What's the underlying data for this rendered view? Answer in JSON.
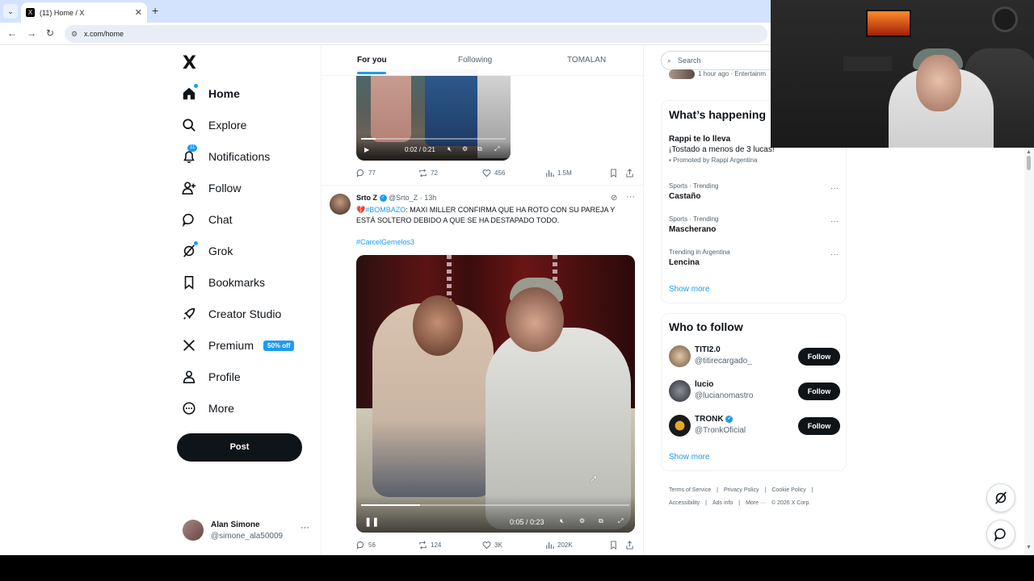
{
  "browser": {
    "tab_title": "(11) Home / X",
    "favicon": "X",
    "url": "x.com/home"
  },
  "nav": {
    "logo": "X",
    "items": [
      {
        "label": "Home",
        "icon": "home-icon",
        "active": true
      },
      {
        "label": "Explore",
        "icon": "search-icon"
      },
      {
        "label": "Notifications",
        "icon": "bell-icon",
        "badge": "11"
      },
      {
        "label": "Follow",
        "icon": "add-person-icon"
      },
      {
        "label": "Chat",
        "icon": "chat-icon"
      },
      {
        "label": "Grok",
        "icon": "grok-icon"
      },
      {
        "label": "Bookmarks",
        "icon": "bookmark-icon"
      },
      {
        "label": "Creator Studio",
        "icon": "rocket-icon"
      },
      {
        "label": "Premium",
        "icon": "x-icon",
        "tag": "50% off"
      },
      {
        "label": "Profile",
        "icon": "person-icon"
      },
      {
        "label": "More",
        "icon": "more-circle-icon"
      }
    ],
    "post_label": "Post",
    "account": {
      "name": "Alan Simone",
      "handle": "@simone_ala50009"
    }
  },
  "feed": {
    "tabs": [
      "For you",
      "Following",
      "TOMALAN"
    ],
    "tweet1": {
      "video_time": "0:02 / 0:21",
      "video_progress": 0.1,
      "replies": "77",
      "reposts": "72",
      "likes": "456",
      "views": "1.5M"
    },
    "tweet2": {
      "name": "Srto Z",
      "handle": "@Srto_Z",
      "time": "13h",
      "emoji": "💔",
      "hashtag1": "#BOMBAZO",
      "text": ": MAXI MILLER CONFIRMA QUE HA ROTO CON SU PAREJA Y ESTÁ SOLTERO DEBIDO A QUE SE HA DESTAPADO TODO.",
      "hashtag2": "#CarcelGemelos3",
      "video_time": "0:05 / 0:23",
      "video_progress": 0.22,
      "replies": "56",
      "reposts": "124",
      "likes": "3K",
      "views": "202K"
    }
  },
  "right": {
    "search_placeholder": "Search",
    "recent_text": "1 hour ago · Entertainm",
    "whats_happening": "What’s happening",
    "promo": {
      "name": "Rappi te lo lleva",
      "desc": "¡Tostado a menos de 3 lucas!",
      "by": "Promoted by Rappi Argentina"
    },
    "trends": [
      {
        "cat": "Sports · Trending",
        "name": "Castaño"
      },
      {
        "cat": "Sports · Trending",
        "name": "Mascherano"
      },
      {
        "cat": "Trending in Argentina",
        "name": "Lencina"
      }
    ],
    "show_more": "Show more",
    "who_to_follow": "Who to follow",
    "follow_label": "Follow",
    "suggestions": [
      {
        "name": "TITI2.0",
        "handle": "@titirecargado_",
        "verified": false
      },
      {
        "name": "lucio",
        "handle": "@lucianomastro",
        "verified": false
      },
      {
        "name": "TRONK",
        "handle": "@TronkOficial",
        "verified": true
      }
    ],
    "footer": [
      "Terms of Service",
      "|",
      "Privacy Policy",
      "|",
      "Cookie Policy",
      "|",
      "Accessibility",
      "|",
      "Ads info",
      "|",
      "More ···",
      "© 2026 X Corp."
    ]
  },
  "colors": {
    "accent": "#1d9bf0",
    "text": "#0f1419",
    "muted": "#536471",
    "button": "#0f1419"
  }
}
